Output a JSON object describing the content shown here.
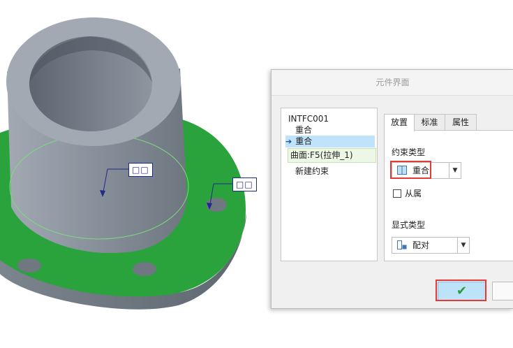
{
  "viewport": {
    "flag_labels": [
      "□□",
      "□□"
    ],
    "colors": {
      "part_gray": "#9aa2ac",
      "surface_green": "#2aa33c",
      "flag_blue": "#1e2a8a"
    }
  },
  "dialog": {
    "title": "元件界面",
    "tree": {
      "root": "INTFC001",
      "constraint": "重合",
      "selected_constraint": "重合",
      "reference": "曲面:F5(拉伸_1)",
      "new_constraint": "新建约束"
    },
    "tabs": [
      {
        "label": "放置",
        "active": true
      },
      {
        "label": "标准",
        "active": false
      },
      {
        "label": "属性",
        "active": false
      }
    ],
    "constraint_type_label": "约束类型",
    "constraint_type_value": "重合",
    "flip_label": "从属",
    "flip_checked": false,
    "offset_type_label": "显式类型",
    "offset_type_value": "配对",
    "ok_icon": "checkmark-icon",
    "ok_symbol": "✔"
  }
}
